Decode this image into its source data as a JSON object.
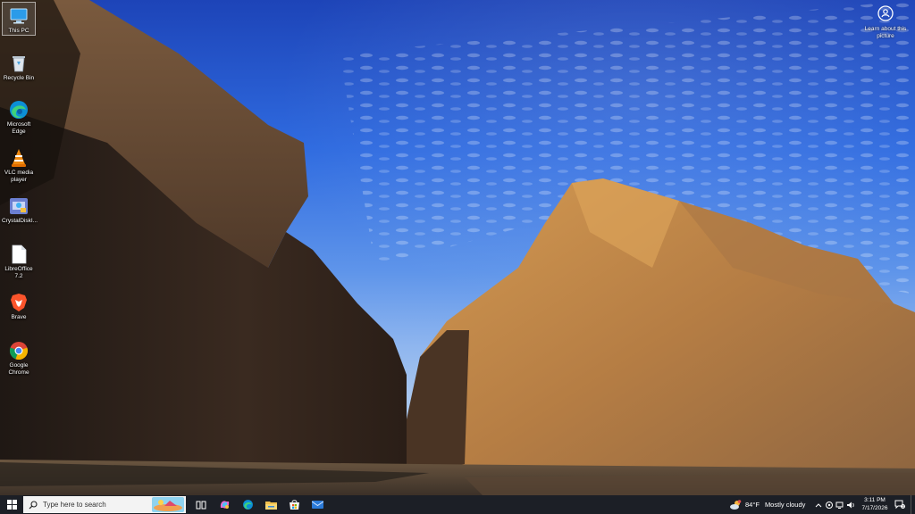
{
  "desktop": {
    "icons": [
      {
        "label": "This PC",
        "icon": "this-pc-icon"
      },
      {
        "label": "Recycle Bin",
        "icon": "recycle-bin-icon"
      },
      {
        "label": "Microsoft Edge",
        "icon": "edge-icon"
      },
      {
        "label": "VLC media player",
        "icon": "vlc-icon"
      },
      {
        "label": "CrystalDiskI...",
        "icon": "crystaldisk-icon"
      },
      {
        "label": "LibreOffice 7.2",
        "icon": "libreoffice-icon"
      },
      {
        "label": "Brave",
        "icon": "brave-icon"
      },
      {
        "label": "Google Chrome",
        "icon": "chrome-icon"
      }
    ],
    "learn_label": "Learn about this picture"
  },
  "taskbar": {
    "search_placeholder": "Type here to search",
    "apps": [
      "task-view-icon",
      "copilot-icon",
      "edge-icon",
      "file-explorer-icon",
      "store-icon",
      "mail-icon"
    ],
    "weather": {
      "temp": "84°F",
      "condition": "Mostly cloudy"
    },
    "clock": {
      "time": "3:11 PM",
      "date": "7/17/2026"
    },
    "notification_count": "3"
  },
  "colors": {
    "taskbar_bg": "#1c1f26",
    "sky_top": "#1d44b8",
    "sky_bottom": "#a8c6ee"
  }
}
